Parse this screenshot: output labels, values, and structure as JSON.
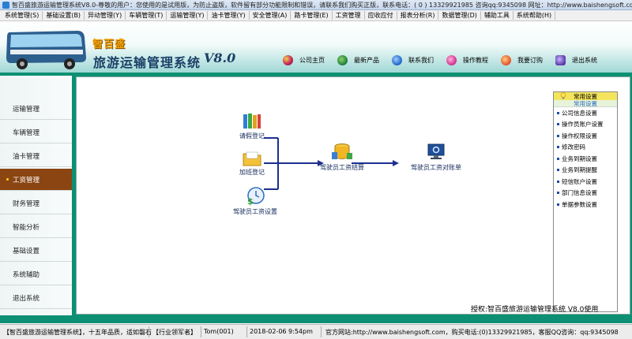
{
  "window": {
    "title": "智百盛旅游运输管理系统V8.0-尊敬的用户：您使用的是试用版，为防止盗版，软件留有部分功能限制和错误，请联系我们购买正版，联系电话：( 0 ) 13329921985  咨询qq:9345098  网址：http://www.baishengsoft.com"
  },
  "menu": [
    "系统管理(S)",
    "基础设置(B)",
    "异动管理(Y)",
    "车辆管理(T)",
    "运输管理(Y)",
    "油卡管理(Y)",
    "安全管理(A)",
    "路卡管理(E)",
    "工资管理",
    "应收应付",
    "报表分析(R)",
    "数据管理(D)",
    "辅助工具",
    "系统帮助(H)"
  ],
  "banner": {
    "brand": "智百盛",
    "system_name": "旅游运输管理系统",
    "version": "V8.0",
    "links": [
      {
        "label": "公司主页",
        "icon": "globe-icon",
        "color": "#c2185b"
      },
      {
        "label": "最新产品",
        "icon": "product-icon",
        "color": "#1b7a3a"
      },
      {
        "label": "联系我们",
        "icon": "contact-icon",
        "color": "#1d62c4"
      },
      {
        "label": "操作教程",
        "icon": "tutorial-icon",
        "color": "#d02c8b"
      },
      {
        "label": "我要订购",
        "icon": "order-icon",
        "color": "#e24b2e"
      },
      {
        "label": "退出系统",
        "icon": "exit-icon",
        "color": "#5a38a6"
      }
    ]
  },
  "sidebar": {
    "items": [
      "运输管理",
      "车辆管理",
      "油卡管理",
      "工资管理",
      "财务管理",
      "智能分析",
      "基础设置",
      "系统辅助",
      "退出系统"
    ],
    "active_index": 3
  },
  "flow": {
    "nodes": {
      "leave": "请假登记",
      "overtime": "加班登记",
      "wage_setting": "驾驶员工资设置",
      "settle": "驾驶员工资结算",
      "statement": "驾驶员工资对账单"
    }
  },
  "right_panel": {
    "header": "常用设置",
    "subheader": "常用设置",
    "items": [
      "公司信息设置",
      "操作员账户设置",
      "操作权限设置",
      "修改密码",
      "业务到期设置",
      "业务到期提醒",
      "短信账户设置",
      "部门信息设置",
      "单据参数设置"
    ]
  },
  "license_text": "授权:智百盛旅游运输管理系统 V8.0使用",
  "status": {
    "app": "【智百盛旅游运输管理系统】，十五年品质，适如磐石",
    "industry": "【行业领军者】",
    "user": "Tom(001)",
    "datetime": "2018-02-06 9:54pm",
    "website": "官方网站:http://www.baishengsoft.com，购买电话:(0)13329921985，客服QQ咨询：qq:9345098"
  },
  "colors": {
    "frame_green": "#0c8f73",
    "active_nav": "#8a4512",
    "flow_line": "#1c2f8f"
  }
}
